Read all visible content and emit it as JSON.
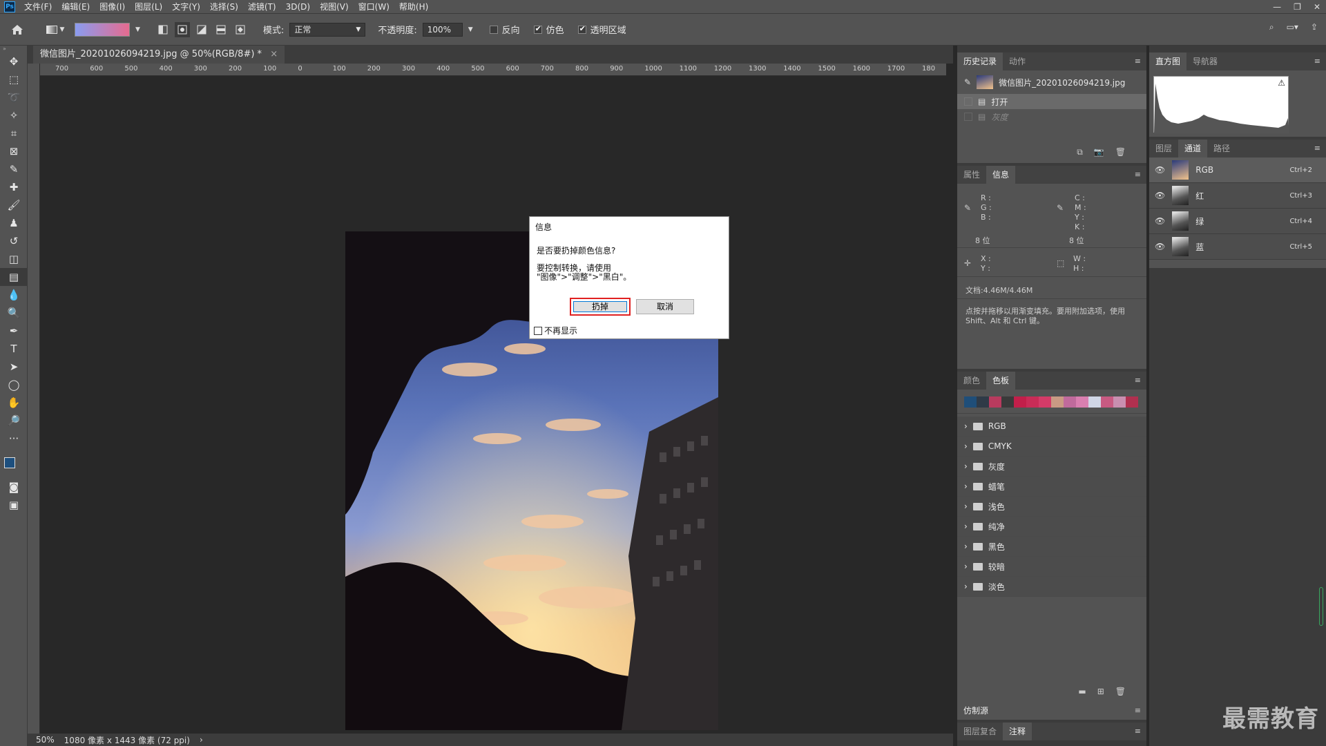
{
  "menubar": {
    "items": [
      "文件(F)",
      "编辑(E)",
      "图像(I)",
      "图层(L)",
      "文字(Y)",
      "选择(S)",
      "滤镜(T)",
      "3D(D)",
      "视图(V)",
      "窗口(W)",
      "帮助(H)"
    ],
    "logo": "Ps"
  },
  "options": {
    "mode_label": "模式:",
    "mode_value": "正常",
    "opacity_label": "不透明度:",
    "opacity_value": "100%",
    "reverse_label": "反向",
    "reverse_checked": false,
    "dither_label": "仿色",
    "dither_checked": true,
    "transparency_label": "透明区域",
    "transparency_checked": true
  },
  "document": {
    "tab_title": "微信图片_20201026094219.jpg @ 50%(RGB/8#) *",
    "zoom": "50%",
    "size_info": "1080 像素 x 1443 像素 (72 ppi)"
  },
  "ruler": {
    "h_ticks": [
      "700",
      "600",
      "500",
      "400",
      "300",
      "200",
      "100",
      "0",
      "100",
      "200",
      "300",
      "400",
      "500",
      "600",
      "700",
      "800",
      "900",
      "1000",
      "1100",
      "1200",
      "1300",
      "1400",
      "1500",
      "1600",
      "1700",
      "180"
    ]
  },
  "dialog": {
    "title": "信息",
    "question": "是否要扔掉颜色信息?",
    "line1": "要控制转换，请使用",
    "line2": "\"图像\">\"调整\">\"黑白\"。",
    "discard_label": "扔掉",
    "cancel_label": "取消",
    "dont_show_label": "不再显示"
  },
  "history_panel": {
    "tabs": [
      "历史记录",
      "动作"
    ],
    "snapshot": "微信图片_20201026094219.jpg",
    "steps": [
      "打开",
      "灰度"
    ]
  },
  "info_panel": {
    "tabs": [
      "属性",
      "信息"
    ],
    "rgb_labels": [
      "R :",
      "G :",
      "B :"
    ],
    "cmyk_labels": [
      "C :",
      "M :",
      "Y :",
      "K :"
    ],
    "bits_left": "8 位",
    "bits_right": "8 位",
    "xy_labels": [
      "X :",
      "Y :"
    ],
    "wh_labels": [
      "W :",
      "H :"
    ],
    "doc_size": "文档:4.46M/4.46M",
    "hint": "点按并拖移以用渐变填充。要用附加选项，使用 Shift、Alt 和 Ctrl 键。"
  },
  "swatches_panel": {
    "tabs": [
      "颜色",
      "色板"
    ],
    "colors": [
      "#1f4e79",
      "#2f3a47",
      "#b83b5e",
      "#3a3a3a",
      "#c21f4a",
      "#c92c57",
      "#d43b68",
      "#c99a84",
      "#c06a9c",
      "#d97fb0",
      "#d0d6e6",
      "#c85a82",
      "#c98fb0",
      "#b0304f"
    ],
    "folders": [
      "RGB",
      "CMYK",
      "灰度",
      "蜡笔",
      "浅色",
      "纯净",
      "黑色",
      "较暗",
      "淡色"
    ]
  },
  "clone_panel": {
    "tabs": [
      "仿制源"
    ]
  },
  "comps_panel": {
    "tabs": [
      "图层复合",
      "注释"
    ]
  },
  "histogram_panel": {
    "tabs": [
      "直方图",
      "导航器"
    ]
  },
  "channels_panel": {
    "tabs": [
      "图层",
      "通道",
      "路径"
    ],
    "channels": [
      {
        "name": "RGB",
        "shortcut": "Ctrl+2"
      },
      {
        "name": "红",
        "shortcut": "Ctrl+3"
      },
      {
        "name": "绿",
        "shortcut": "Ctrl+4"
      },
      {
        "name": "蓝",
        "shortcut": "Ctrl+5"
      }
    ]
  },
  "watermark": "最需教育"
}
